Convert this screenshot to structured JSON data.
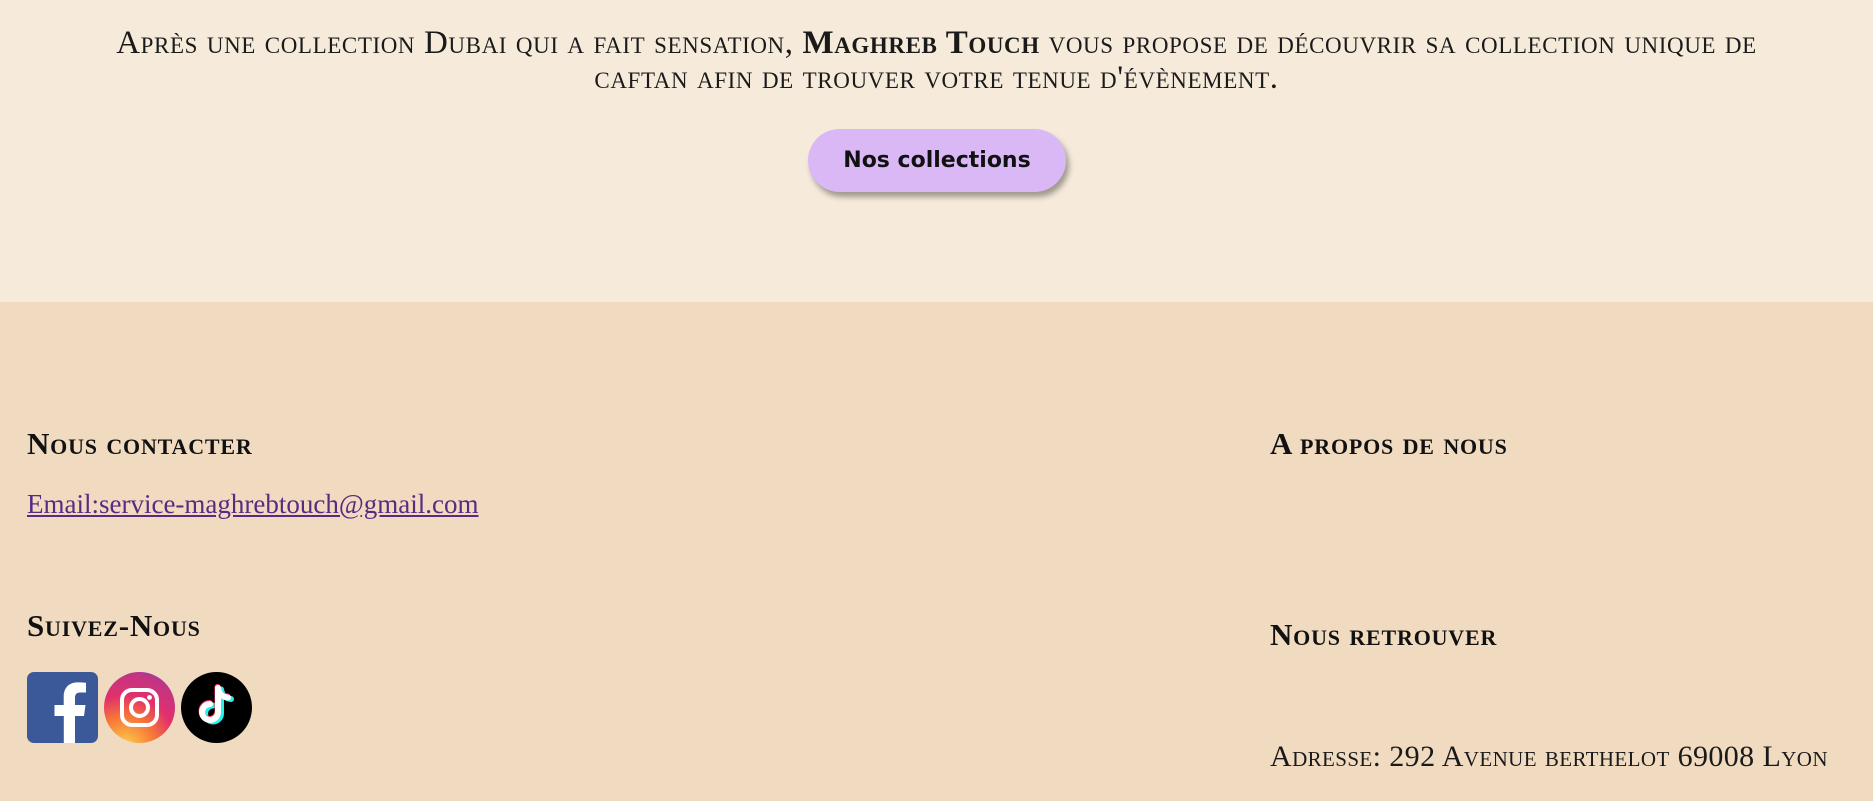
{
  "hero": {
    "text_before": "Après une collection Dubai qui a fait sensation, ",
    "brand": "Maghreb Touch",
    "text_after": " vous propose de découvrir sa collection unique de caftan afin de trouver votre tenue d'évènement.",
    "cta_label": "Nos collections"
  },
  "footer": {
    "contact_heading": "Nous contacter",
    "email_link": "Email:service-maghrebtouch@gmail.com",
    "follow_heading": "Suivez-Nous",
    "social": [
      {
        "name": "facebook",
        "icon": "facebook-icon",
        "color": "#3b5998"
      },
      {
        "name": "instagram",
        "icon": "instagram-icon",
        "color": "#e1306c"
      },
      {
        "name": "tiktok",
        "icon": "tiktok-icon",
        "color": "#000000"
      }
    ],
    "about_heading": "A propos de nous",
    "find_heading": "Nous retrouver",
    "address": "Adresse: 292 Avenue berthelot 69008 Lyon"
  },
  "colors": {
    "hero_bg": "#f6eadb",
    "footer_bg": "#f1dbc0",
    "cta_bg": "#d9b8f5",
    "link": "#5a2a82"
  }
}
